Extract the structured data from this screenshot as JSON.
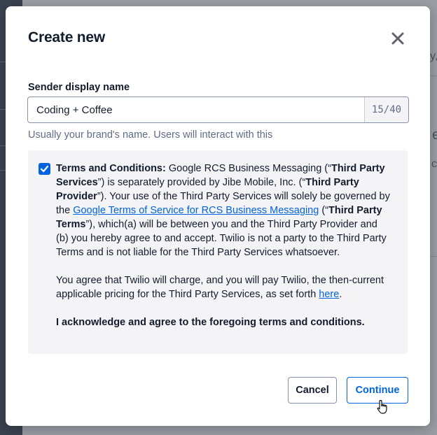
{
  "background": {
    "fragments": [
      "y,",
      "e",
      "c"
    ]
  },
  "modal": {
    "title": "Create new",
    "close_icon": "close-icon"
  },
  "sender_field": {
    "label": "Sender display name",
    "value": "Coding + Coffee",
    "char_count": "15/40",
    "help_text": "Usually your brand's name. Users will interact with this"
  },
  "terms": {
    "checked": true,
    "heading": "Terms and Conditions:",
    "p1_a": " Google RCS Business Messaging (“",
    "p1_third_party_services": "Third Party Services",
    "p1_b": "”) is separately provided by Jibe Mobile, Inc. (“",
    "p1_third_party_provider": "Third Party Provider",
    "p1_c": "”). Your use of the Third Party Services will solely be governed by the ",
    "p1_link": "Google Terms of Service for RCS Business Messaging",
    "p1_d": " (“",
    "p1_third_party_terms": "Third Party Terms",
    "p1_e": "”), which(a) will be between you and the Third Party Provider and (b) you hereby agree to and accept. Twilio is not a party to the Third Party Terms and is not liable for the Third Party Services whatsoever.",
    "p2_a": "You agree that Twilio will charge, and you will pay Twilio, the then-current applicable pricing for the Third Party Services, as set forth ",
    "p2_link": "here",
    "p2_b": ".",
    "p3": "I acknowledge and agree to the foregoing terms and conditions."
  },
  "actions": {
    "cancel_label": "Cancel",
    "continue_label": "Continue"
  },
  "colors": {
    "primary": "#0263e0",
    "text": "#121c2d",
    "muted": "#606b85",
    "panel": "#f4f4f6"
  }
}
